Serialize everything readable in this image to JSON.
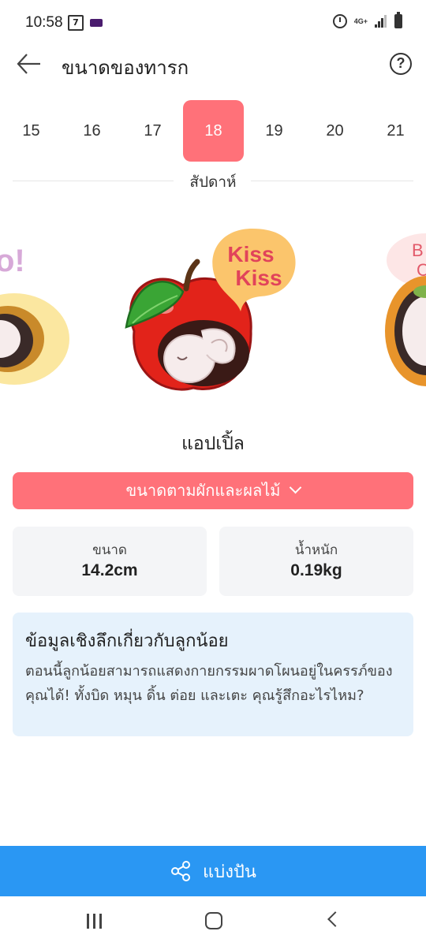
{
  "status_bar": {
    "time": "10:58",
    "network": "4G+"
  },
  "app_bar": {
    "title": "ขนาดของทารก",
    "back_icon": "arrow-left-icon",
    "help_icon": "question-circle-icon",
    "help_glyph": "?"
  },
  "weeks": {
    "items": [
      "15",
      "16",
      "17",
      "18",
      "19",
      "20",
      "21"
    ],
    "selected": "18",
    "unit_label": "สัปดาห์"
  },
  "fruit": {
    "bubble_text_line1": "Kiss",
    "bubble_text_line2": "Kiss",
    "left_peek_text": "o!",
    "right_peek_text": "B",
    "right_peek_text2": "C",
    "name": "แอปเปิ้ล",
    "colors": {
      "apple": "#e2231a",
      "leaf": "#3aa535",
      "bubble": "#fbc56c",
      "bubble_text": "#e1435a"
    }
  },
  "size_button": {
    "label": "ขนาดตามผักและผลไม้",
    "icon": "chevron-down-icon"
  },
  "stats": {
    "size_label": "ขนาด",
    "size_value": "14.2cm",
    "weight_label": "น้ำหนัก",
    "weight_value": "0.19kg"
  },
  "insight": {
    "title": "ข้อมูลเชิงลึกเกี่ยวกับลูกน้อย",
    "body": "ตอนนี้ลูกน้อยสามารถแสดงกายกรรมผาดโผนอยู่ในครรภ์ของคุณได้! ทั้งบิด หมุน ดิ้น ต่อย และเตะ คุณรู้สึกอะไรไหม?"
  },
  "share": {
    "label": "แบ่งปัน",
    "icon": "share-icon",
    "color": "#2a97f3"
  },
  "accent_color": "#ff7179"
}
